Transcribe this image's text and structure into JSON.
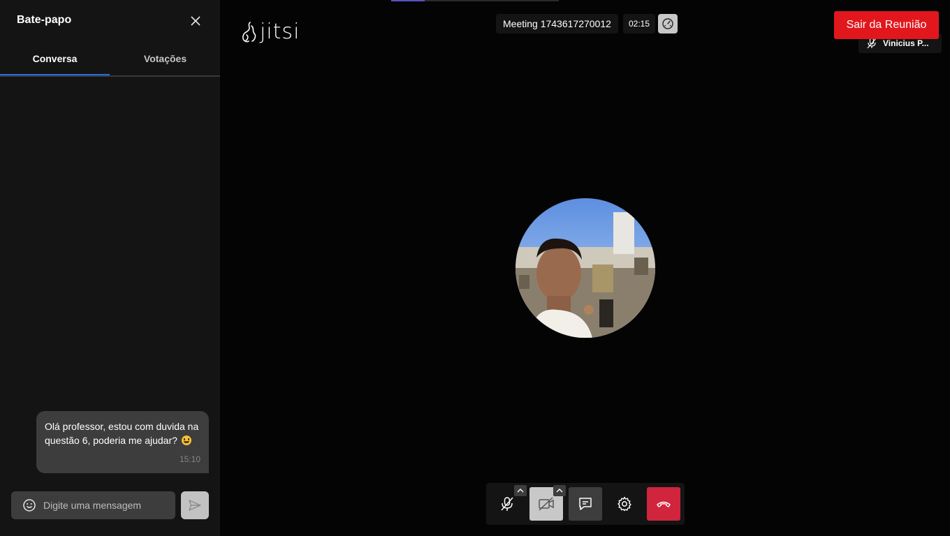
{
  "chat": {
    "title": "Bate-papo",
    "tabs": [
      {
        "label": "Conversa",
        "active": true
      },
      {
        "label": "Votações",
        "active": false
      }
    ],
    "message": {
      "text": "Olá professor, estou com duvida na questão 6, poderia me ajudar?",
      "emoji": "grinning-face",
      "time": "15:10"
    },
    "input": {
      "placeholder": "Digite uma mensagem"
    }
  },
  "header": {
    "logo": "jitsi",
    "meeting_title": "Meeting 1743617270012",
    "timer": "02:15",
    "leave_label": "Sair da Reunião",
    "participant_name": "Vinicius P..."
  },
  "toolbar": {
    "buttons": [
      {
        "name": "microphone-muted",
        "icon": "mic-off-icon"
      },
      {
        "name": "camera-off",
        "icon": "camera-off-icon"
      },
      {
        "name": "chat",
        "icon": "chat-icon"
      },
      {
        "name": "settings",
        "icon": "gear-icon"
      },
      {
        "name": "hangup",
        "icon": "hangup-icon"
      }
    ]
  },
  "colors": {
    "accent_blue": "#246fe5",
    "leave_red": "#e2171d",
    "hangup_red": "#d0253d",
    "panel_bg": "#141414",
    "bubble_bg": "#3d3d3d"
  }
}
